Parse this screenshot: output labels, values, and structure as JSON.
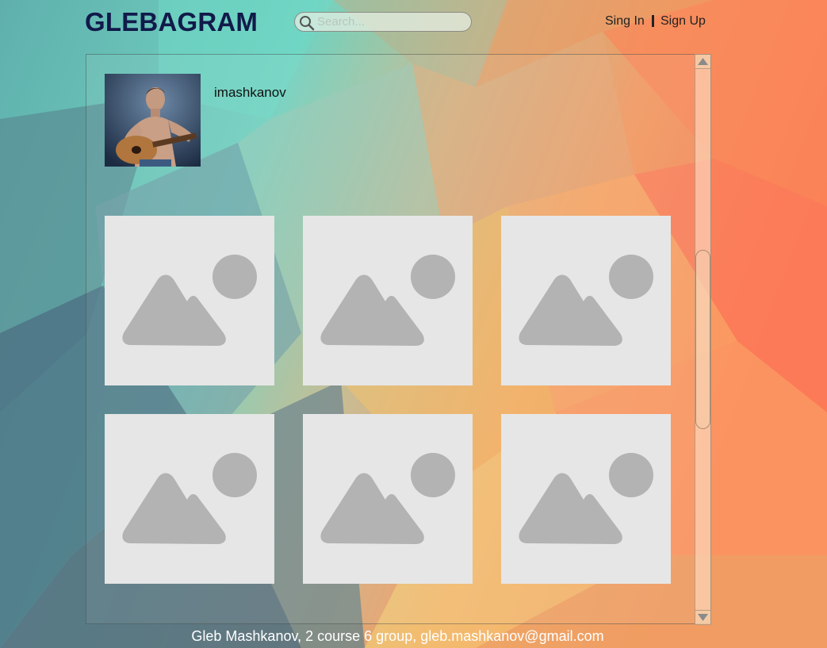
{
  "header": {
    "logo": "GLEBAGRAM",
    "search": {
      "placeholder": "Search...",
      "value": ""
    },
    "sign_in": "Sing In",
    "sign_up": "Sign Up"
  },
  "profile": {
    "username": "imashkanov",
    "avatar": "profile-photo"
  },
  "gallery": {
    "items": [
      {
        "icon": "image-placeholder-icon"
      },
      {
        "icon": "image-placeholder-icon"
      },
      {
        "icon": "image-placeholder-icon"
      },
      {
        "icon": "image-placeholder-icon"
      },
      {
        "icon": "image-placeholder-icon"
      },
      {
        "icon": "image-placeholder-icon"
      }
    ]
  },
  "footer": {
    "text": "Gleb Mashkanov, 2 course 6 group, gleb.mashkanov@gmail.com"
  },
  "colors": {
    "logo": "#111a4a",
    "placeholder_bg": "#e6e6e6",
    "placeholder_icon": "#b3b3b3",
    "footer_text": "#ffffff"
  }
}
